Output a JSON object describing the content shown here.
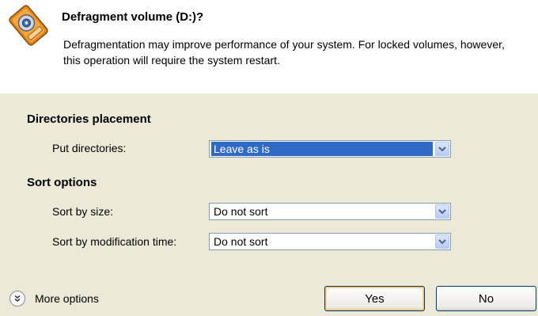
{
  "dialog": {
    "title": "Defragment volume (D:)?",
    "description": "Defragmentation may improve performance of your system. For locked volumes, however, this operation will require the system restart.",
    "icon": "defragment-disk-icon"
  },
  "directories_placement": {
    "heading": "Directories placement",
    "put_directories": {
      "label": "Put directories:",
      "value": "Leave as is"
    }
  },
  "sort_options": {
    "heading": "Sort options",
    "sort_by_size": {
      "label": "Sort by size:",
      "value": "Do not sort"
    },
    "sort_by_modification_time": {
      "label": "Sort by modification time:",
      "value": "Do not sort"
    }
  },
  "footer": {
    "more_options_label": "More options",
    "more_options_icon": "chevron-double-down-icon",
    "yes_label": "Yes",
    "no_label": "No"
  },
  "colors": {
    "selection": "#316ac5",
    "dialog_background": "#ece9d8",
    "header_background": "#ffffff"
  }
}
